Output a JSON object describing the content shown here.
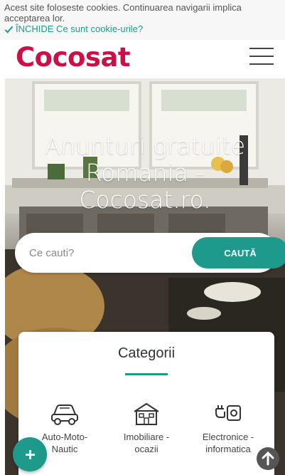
{
  "cookie": {
    "message": "Acest site foloseste cookies. Continuarea navigarii implica acceptarea lor.",
    "close_label": "ÎNCHIDE Ce sunt cookie-urile?",
    "close_icon": "check-icon"
  },
  "header": {
    "logo_text": "Cocosat",
    "menu_icon": "hamburger-menu-icon"
  },
  "hero": {
    "title": "Anunturi gratuite Romania - Cocosat.ro."
  },
  "search": {
    "placeholder": "Ce cauti?",
    "button_label": "CAUTĂ"
  },
  "categories": {
    "title": "Categorii",
    "items": [
      {
        "label": "Auto-Moto-\nNautic",
        "icon": "car-icon"
      },
      {
        "label": "Imobiliare -\nocazii",
        "icon": "house-icon"
      },
      {
        "label": "Electronice -\ninformatica",
        "icon": "electronics-plug-icon"
      }
    ]
  },
  "colors": {
    "brand": "#cc1045",
    "accent": "#1d9a8b"
  },
  "floating": {
    "add_icon": "plus-icon",
    "scroll_icon": "arrow-up-icon"
  }
}
